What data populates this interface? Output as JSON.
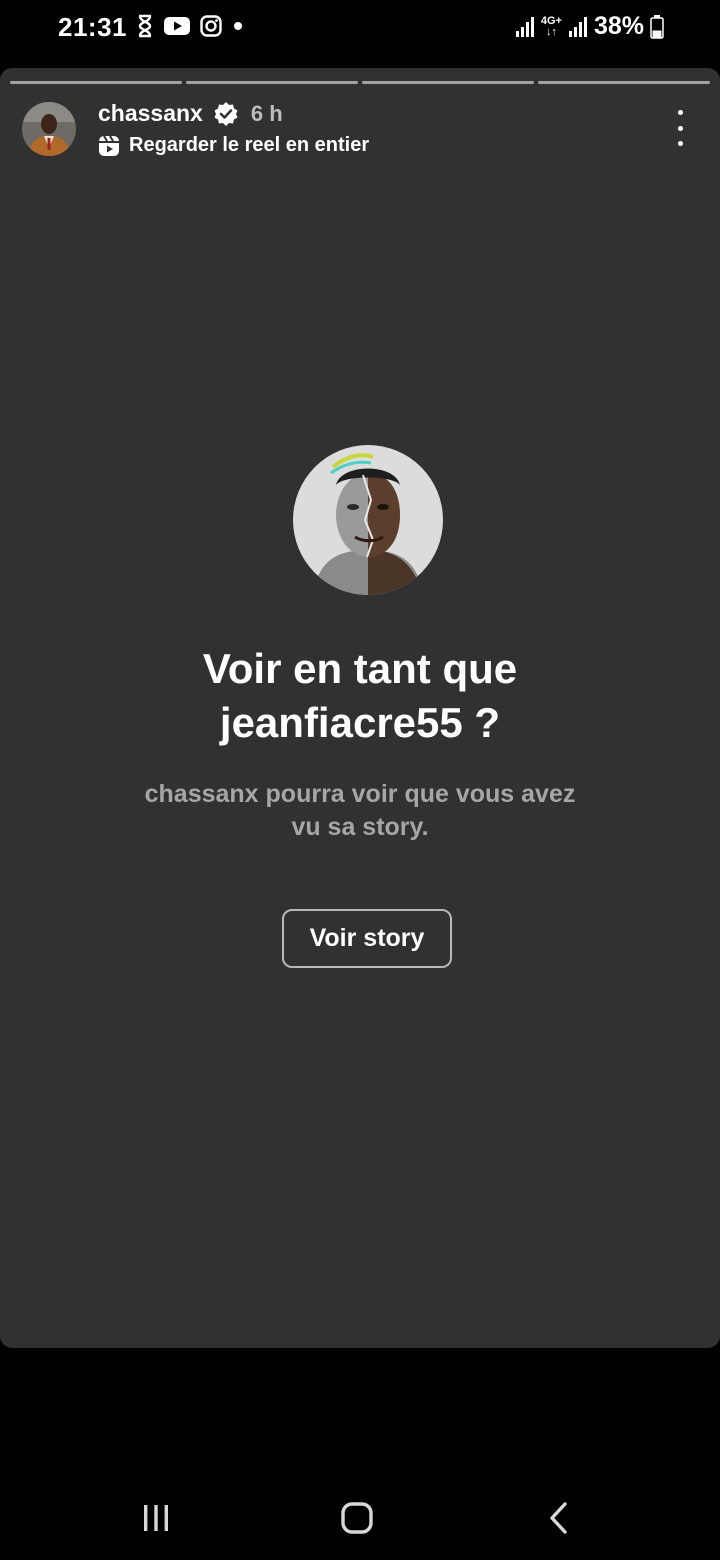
{
  "status_bar": {
    "time": "21:31",
    "notification_icons": [
      "hourglass-icon",
      "youtube-icon",
      "instagram-icon",
      "dot-icon"
    ],
    "network_label_top": "4G+",
    "network_label_bottom": "↓↑",
    "battery_percent": "38%",
    "battery_level": 0.38
  },
  "story": {
    "progress_segments": 4,
    "author": {
      "username": "chassanx",
      "verified": true,
      "time_ago": "6 h"
    },
    "reel_link_label": "Regarder le reel en entier",
    "prompt": {
      "headline_line1": "Voir en tant que",
      "headline_line2": "jeanfiacre55 ?",
      "subtitle": "chassanx pourra voir que vous avez vu sa story.",
      "button_label": "Voir story"
    }
  },
  "navigation": {
    "buttons": [
      "recent-apps-icon",
      "home-icon",
      "back-icon"
    ]
  },
  "colors": {
    "story_background": "#313131",
    "page_background": "#000000",
    "subtitle": "#a6a6a6",
    "button_border": "#b8b8b8"
  }
}
